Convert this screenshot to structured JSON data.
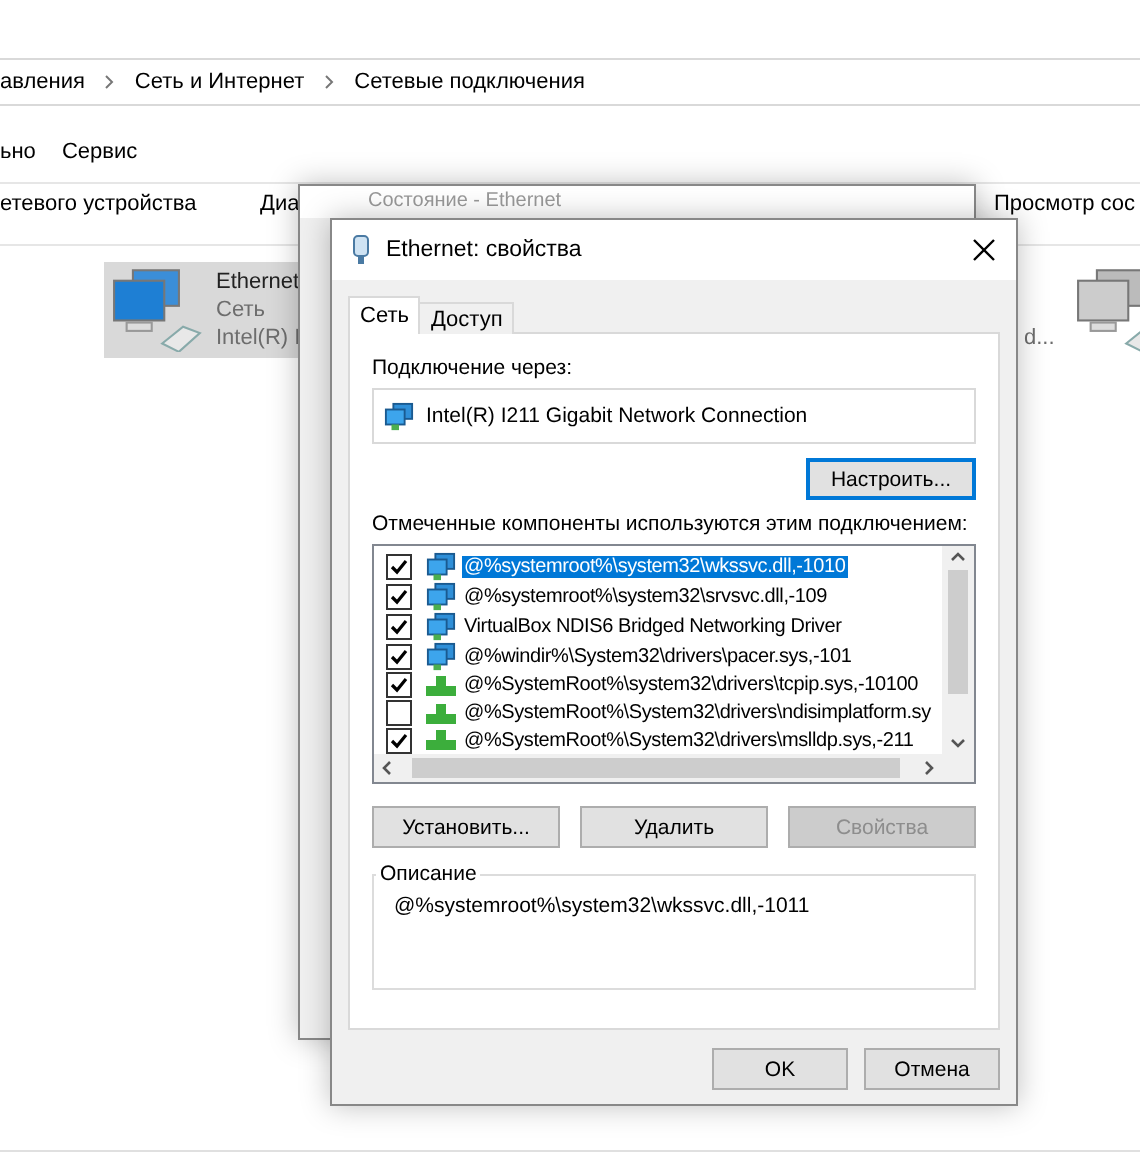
{
  "explorer": {
    "breadcrumb": [
      "авления",
      "Сеть и Интернет",
      "Сетевые подключения"
    ],
    "menu": [
      "ьно",
      "Сервис"
    ],
    "toolbar": [
      "етевого устройства",
      "Диа",
      "Просмотр сос"
    ],
    "items": [
      {
        "name": "Ethernet",
        "lines": [
          "Сеть",
          "Intel(R) I"
        ],
        "selected": true
      },
      {
        "lines": [
          "d..."
        ],
        "selected": false
      }
    ]
  },
  "status_window": {
    "title": "Состояние - Ethernet"
  },
  "dialog": {
    "title": "Ethernet: свойства",
    "tabs": [
      {
        "label": "Сеть",
        "selected": true
      },
      {
        "label": "Доступ",
        "selected": false
      }
    ],
    "connect_label": "Подключение через:",
    "adapter": "Intel(R) I211 Gigabit Network Connection",
    "configure_button": "Настроить...",
    "components_label": "Отмеченные компоненты используются этим подключением:",
    "components": [
      {
        "kind": "network",
        "text": "@%systemroot%\\system32\\wkssvc.dll,-1010",
        "checked": true,
        "selected": true
      },
      {
        "kind": "network",
        "text": "@%systemroot%\\system32\\srvsvc.dll,-109",
        "checked": true,
        "selected": false
      },
      {
        "kind": "network",
        "text": "VirtualBox NDIS6 Bridged Networking Driver",
        "checked": true,
        "selected": false
      },
      {
        "kind": "network",
        "text": "@%windir%\\System32\\drivers\\pacer.sys,-101",
        "checked": true,
        "selected": false
      },
      {
        "kind": "protocol",
        "text": "@%SystemRoot%\\system32\\drivers\\tcpip.sys,-10100",
        "checked": true,
        "selected": false
      },
      {
        "kind": "protocol",
        "text": "@%SystemRoot%\\System32\\drivers\\ndisimplatform.sy",
        "checked": false,
        "selected": false
      },
      {
        "kind": "protocol",
        "text": "@%SystemRoot%\\System32\\drivers\\mslldp.sys,-211",
        "checked": true,
        "selected": false
      }
    ],
    "action_buttons": [
      {
        "label": "Установить...",
        "disabled": false
      },
      {
        "label": "Удалить",
        "disabled": false
      },
      {
        "label": "Свойства",
        "disabled": true
      }
    ],
    "description_title": "Описание",
    "description": "@%systemroot%\\system32\\wkssvc.dll,-1011",
    "buttons": [
      "OK",
      "Отмена"
    ]
  }
}
